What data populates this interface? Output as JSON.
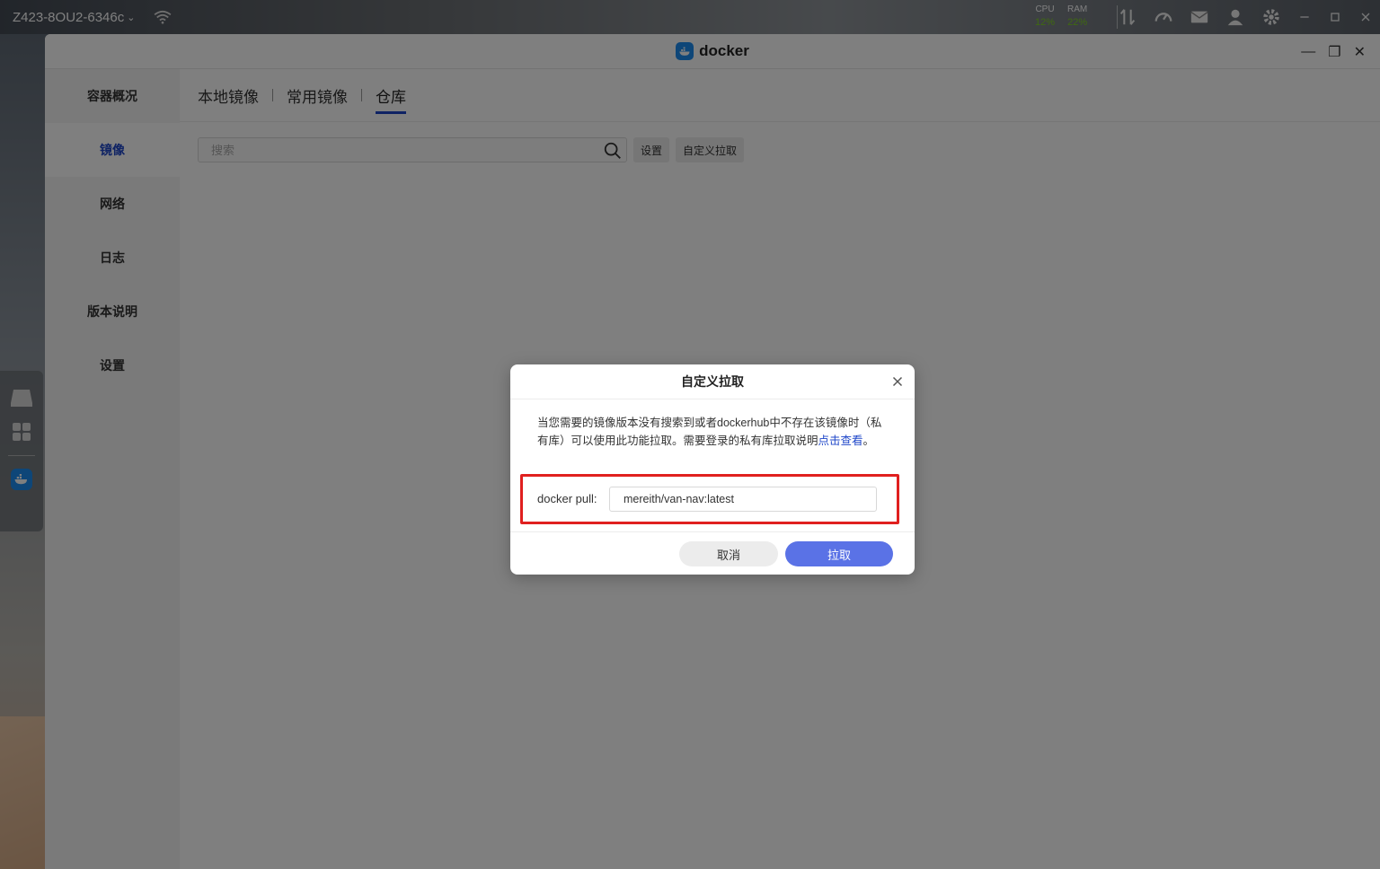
{
  "system_bar": {
    "device_name": "Z423-8OU2-6346c",
    "cpu_label": "CPU",
    "cpu_value": "12%",
    "ram_label": "RAM",
    "ram_value": "22%"
  },
  "window": {
    "title": "docker"
  },
  "sidebar": {
    "items": [
      {
        "label": "容器概况"
      },
      {
        "label": "镜像"
      },
      {
        "label": "网络"
      },
      {
        "label": "日志"
      },
      {
        "label": "版本说明"
      },
      {
        "label": "设置"
      }
    ],
    "selected_index": 1
  },
  "tabs": [
    {
      "label": "本地镜像"
    },
    {
      "label": "常用镜像"
    },
    {
      "label": "仓库"
    }
  ],
  "toolbar": {
    "search_placeholder": "搜索",
    "settings_label": "设置",
    "custom_pull_label": "自定义拉取"
  },
  "dialog": {
    "title": "自定义拉取",
    "description": "当您需要的镜像版本没有搜索到或者dockerhub中不存在该镜像时（私有库）可以使用此功能拉取。需要登录的私有库拉取说明",
    "link_text": "点击查看",
    "description_end": "。",
    "pull_label": "docker pull:",
    "pull_value": "mereith/van-nav:latest",
    "cancel_label": "取消",
    "pull_button_label": "拉取"
  },
  "colors": {
    "accent": "#1f47c9",
    "primary_button": "#5a72e6",
    "highlight_border": "#e0201f"
  }
}
